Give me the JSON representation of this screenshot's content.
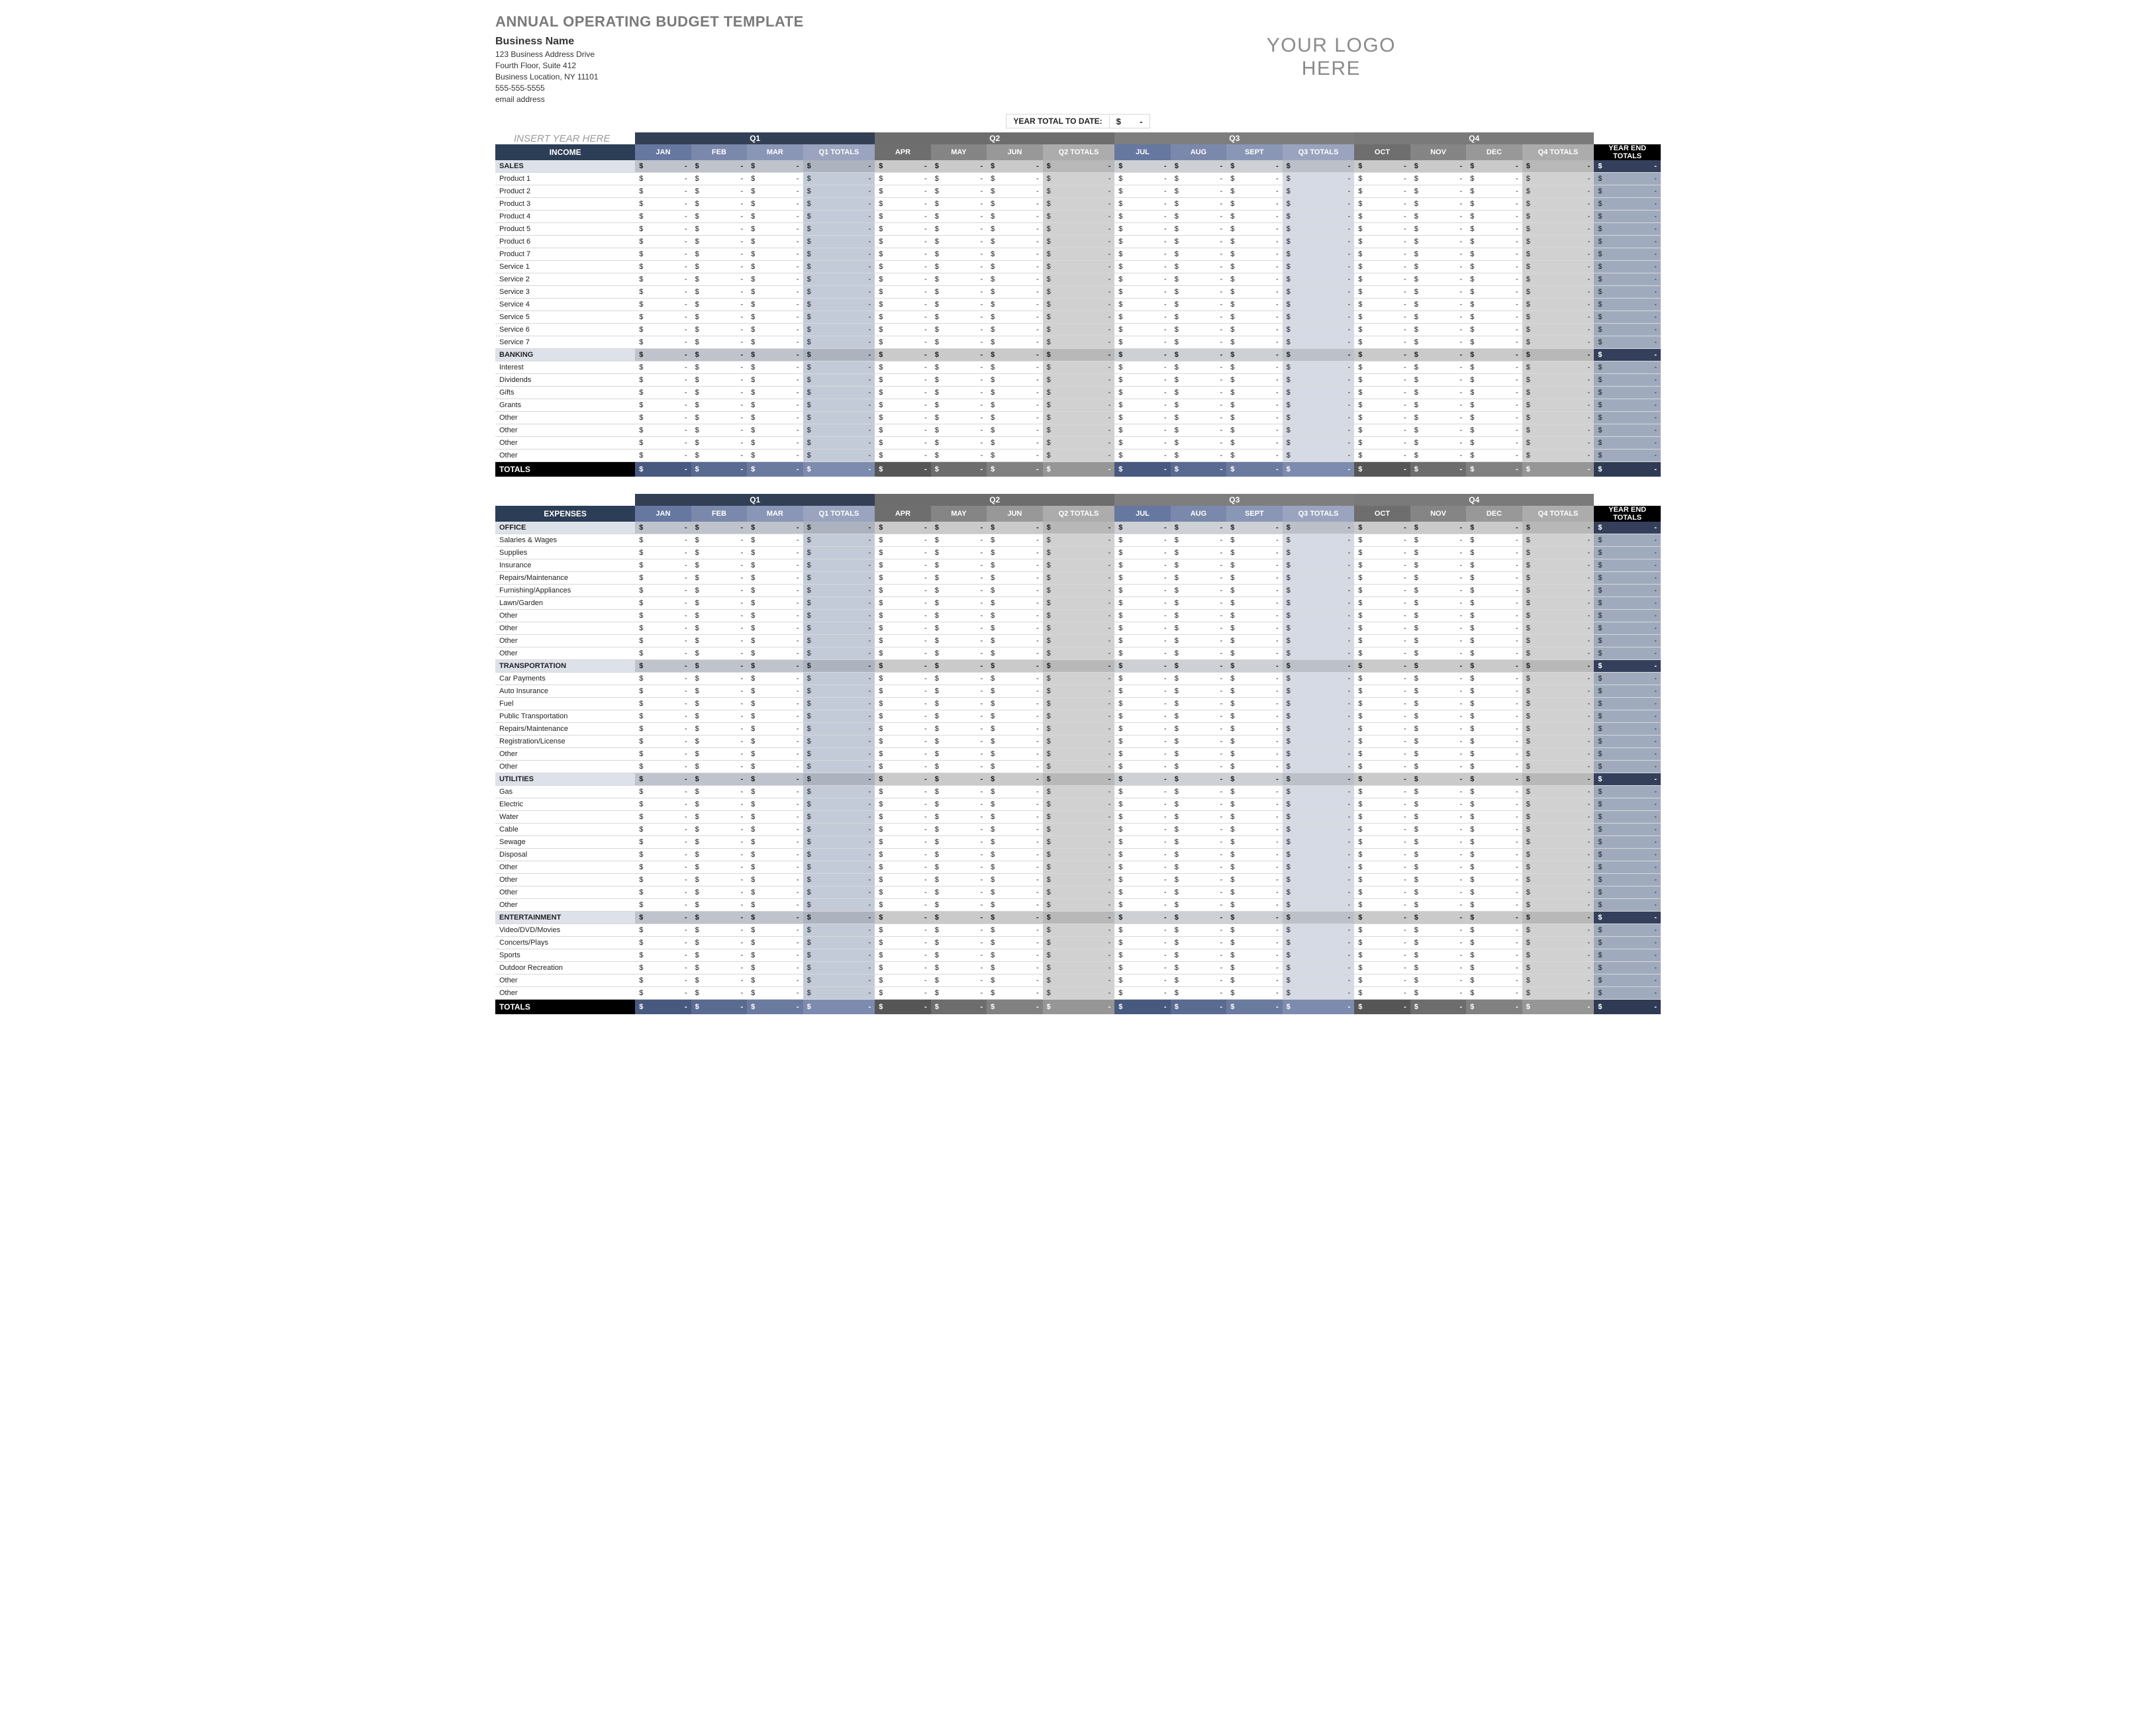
{
  "title": "ANNUAL OPERATING BUDGET TEMPLATE",
  "business": {
    "name": "Business Name",
    "addr1": "123 Business Address Drive",
    "addr2": "Fourth Floor, Suite 412",
    "addr3": "Business Location, NY  11101",
    "phone": "555-555-5555",
    "email": "email address"
  },
  "logo": {
    "line1": "YOUR LOGO",
    "line2": "HERE"
  },
  "year_total_to_date": {
    "label": "YEAR TOTAL TO DATE:",
    "symbol": "$",
    "value": "-"
  },
  "insert_year": "INSERT YEAR HERE",
  "quarters": [
    "Q1",
    "Q2",
    "Q3",
    "Q4"
  ],
  "months": {
    "q1": [
      "JAN",
      "FEB",
      "MAR",
      "Q1 TOTALS"
    ],
    "q2": [
      "APR",
      "MAY",
      "JUN",
      "Q2 TOTALS"
    ],
    "q3": [
      "JUL",
      "AUG",
      "SEPT",
      "Q3 TOTALS"
    ],
    "q4": [
      "OCT",
      "NOV",
      "DEC",
      "Q4 TOTALS"
    ]
  },
  "year_end_label": "YEAR END TOTALS",
  "section_labels": {
    "income": "INCOME",
    "expenses": "EXPENSES"
  },
  "totals_label": "TOTALS",
  "currency_symbol": "$",
  "dash": "-",
  "income": [
    {
      "type": "category",
      "label": "SALES"
    },
    {
      "type": "item",
      "label": "Product 1"
    },
    {
      "type": "item",
      "label": "Product 2"
    },
    {
      "type": "item",
      "label": "Product 3"
    },
    {
      "type": "item",
      "label": "Product 4"
    },
    {
      "type": "item",
      "label": "Product 5"
    },
    {
      "type": "item",
      "label": "Product 6"
    },
    {
      "type": "item",
      "label": "Product 7"
    },
    {
      "type": "item",
      "label": "Service 1"
    },
    {
      "type": "item",
      "label": "Service 2"
    },
    {
      "type": "item",
      "label": "Service 3"
    },
    {
      "type": "item",
      "label": "Service 4"
    },
    {
      "type": "item",
      "label": "Service 5"
    },
    {
      "type": "item",
      "label": "Service 6"
    },
    {
      "type": "item",
      "label": "Service 7"
    },
    {
      "type": "category",
      "label": "BANKING"
    },
    {
      "type": "item",
      "label": "Interest"
    },
    {
      "type": "item",
      "label": "Dividends"
    },
    {
      "type": "item",
      "label": "Gifts"
    },
    {
      "type": "item",
      "label": "Grants"
    },
    {
      "type": "item",
      "label": "Other"
    },
    {
      "type": "item",
      "label": "Other"
    },
    {
      "type": "item",
      "label": "Other"
    },
    {
      "type": "item",
      "label": "Other"
    }
  ],
  "expenses": [
    {
      "type": "category",
      "label": "OFFICE"
    },
    {
      "type": "item",
      "label": "Salaries & Wages"
    },
    {
      "type": "item",
      "label": "Supplies"
    },
    {
      "type": "item",
      "label": "Insurance"
    },
    {
      "type": "item",
      "label": "Repairs/Maintenance"
    },
    {
      "type": "item",
      "label": "Furnishing/Appliances"
    },
    {
      "type": "item",
      "label": "Lawn/Garden"
    },
    {
      "type": "item",
      "label": "Other"
    },
    {
      "type": "item",
      "label": "Other"
    },
    {
      "type": "item",
      "label": "Other"
    },
    {
      "type": "item",
      "label": "Other"
    },
    {
      "type": "category",
      "label": "TRANSPORTATION"
    },
    {
      "type": "item",
      "label": "Car Payments"
    },
    {
      "type": "item",
      "label": "Auto Insurance"
    },
    {
      "type": "item",
      "label": "Fuel"
    },
    {
      "type": "item",
      "label": "Public Transportation"
    },
    {
      "type": "item",
      "label": "Repairs/Maintenance"
    },
    {
      "type": "item",
      "label": "Registration/License"
    },
    {
      "type": "item",
      "label": "Other"
    },
    {
      "type": "item",
      "label": "Other"
    },
    {
      "type": "category",
      "label": "UTILITIES"
    },
    {
      "type": "item",
      "label": "Gas"
    },
    {
      "type": "item",
      "label": "Electric"
    },
    {
      "type": "item",
      "label": "Water"
    },
    {
      "type": "item",
      "label": "Cable"
    },
    {
      "type": "item",
      "label": "Sewage"
    },
    {
      "type": "item",
      "label": "Disposal"
    },
    {
      "type": "item",
      "label": "Other"
    },
    {
      "type": "item",
      "label": "Other"
    },
    {
      "type": "item",
      "label": "Other"
    },
    {
      "type": "item",
      "label": "Other"
    },
    {
      "type": "category",
      "label": "ENTERTAINMENT"
    },
    {
      "type": "item",
      "label": "Video/DVD/Movies"
    },
    {
      "type": "item",
      "label": "Concerts/Plays"
    },
    {
      "type": "item",
      "label": "Sports"
    },
    {
      "type": "item",
      "label": "Outdoor Recreation"
    },
    {
      "type": "item",
      "label": "Other"
    },
    {
      "type": "item",
      "label": "Other"
    }
  ]
}
